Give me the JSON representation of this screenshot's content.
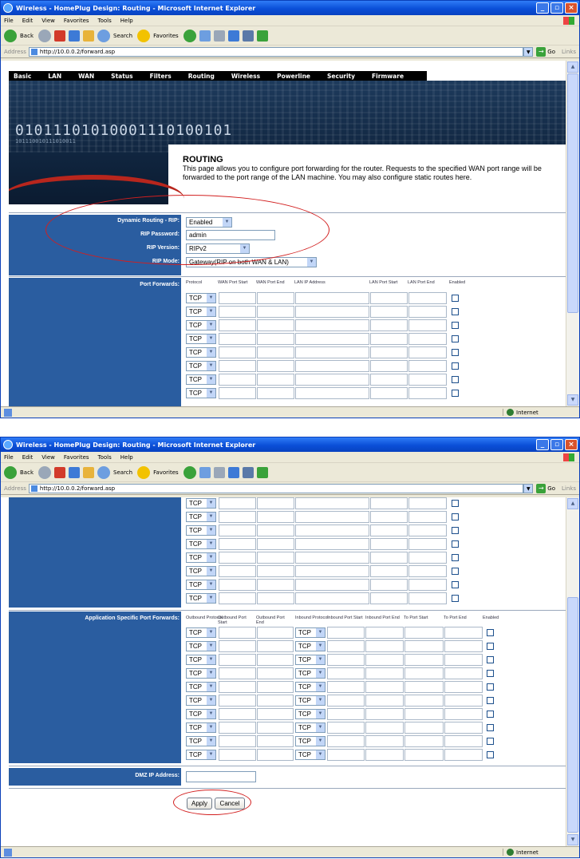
{
  "window": {
    "title": "Wireless - HomePlug Design: Routing - Microsoft Internet Explorer",
    "menu": [
      "File",
      "Edit",
      "View",
      "Favorites",
      "Tools",
      "Help"
    ],
    "toolbar": {
      "back": "Back",
      "search": "Search",
      "favorites": "Favorites"
    },
    "address_label": "Address",
    "url": "http://10.0.0.2/forward.asp",
    "go": "Go",
    "links": "Links",
    "status_zone": "Internet"
  },
  "nav": [
    "Basic",
    "LAN",
    "WAN",
    "Status",
    "Filters",
    "Routing",
    "Wireless",
    "Powerline",
    "Security",
    "Firmware"
  ],
  "banner": {
    "binary": "01011101010001110100101",
    "binary_small": "101110010111010011"
  },
  "page": {
    "title": "ROUTING",
    "description": "This page allows you to configure port forwarding for the router. Requests to the specified WAN port range will be forwarded to the port range of the LAN machine. You may also configure static routes here."
  },
  "rip": {
    "dynamic_label": "Dynamic Routing - RIP:",
    "dynamic_value": "Enabled",
    "password_label": "RIP Password:",
    "password_value": "admin",
    "version_label": "RIP Version:",
    "version_value": "RIPv2",
    "mode_label": "RIP Mode:",
    "mode_value": "Gateway(RIP on both WAN & LAN)"
  },
  "port_forwards": {
    "label": "Port Forwards:",
    "headers": [
      "Protocol",
      "WAN Port Start",
      "WAN Port End",
      "LAN IP Address",
      "LAN Port Start",
      "LAN Port End",
      "Enabled"
    ],
    "protocol": "TCP"
  },
  "app_forwards": {
    "label": "Application Specific Port Forwards:",
    "headers": [
      "Outbound Protocol",
      "Outbound Port Start",
      "Outbound Port End",
      "Inbound Protocol",
      "Inbound Port Start",
      "Inbound Port End",
      "To Port Start",
      "To Port End",
      "Enabled"
    ],
    "protocol": "TCP"
  },
  "dmz": {
    "label": "DMZ IP Address:"
  },
  "buttons": {
    "apply": "Apply",
    "cancel": "Cancel"
  }
}
